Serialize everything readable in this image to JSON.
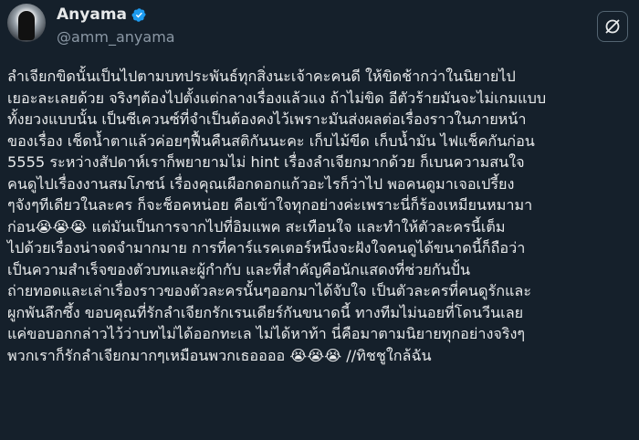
{
  "author": {
    "name": "Anyama",
    "handle": "@amm_anyama"
  },
  "post": {
    "lines": [
      "ลำเจียกขิดนั้นเป็นไปตามบทประพันธ์ทุกสิ่งนะเจ้าคะคนดี ให้ขิดช้ากว่าในนิยายไป",
      "เยอะละเลยด้วย จริงๆต้องไปตั้งแต่กลางเรื่องแล้วแง ถ้าไม่ขิด อีตัวร้ายมันจะไม่เกมแบบ",
      "ทั้งยวงแบบนั้น เป็นซีเควนซ์ที่จำเป็นต้องคงไว้เพราะมันส่งผลต่อเรื่องราวในภายหน้า",
      "ของเรื่อง เช็ดน้ำตาแล้วค่อยๆฟื้นคืนสติกันนะคะ เก็บไม้ขีด เก็บน้ำมัน ไฟแช็คกันก่อน",
      "5555  ระหว่างสัปดาห์เราก็พยายามไม่ hint เรื่องลำเจียกมากด้วย ก็เบนความสนใจ",
      "คนดูไปเรื่องงานสมโภชน์ เรื่องคุณเผือกดอกแก้วอะไรก็ว่าไป พอคนดูมาเจอเปรี้ยง",
      "ๆจังๆทีเดียวในละคร ก็จะช็อคหน่อย คือเข้าใจทุกอย่างค่ะเพราะนี่ก็ร้องเหมียนหมามา",
      "ก่อน😭😭😭 แต่มันเป็นการจากไปที่อิมแพค สะเทือนใจ และทำให้ตัวละครนี้เต็ม",
      "ไปด้วยเรื่องน่าจดจำมากมาย การที่คาร์แรคเตอร์หนึ่งจะฝังใจคนดูได้ขนาดนี้ก็ถือว่า",
      "เป็นความสำเร็จของตัวบทและผู้กำกับ และที่สำคัญคือนักแสดงที่ช่วยกันปั้น",
      "ถ่ายทอดและเล่าเรื่องราวของตัวละครนั้นๆออกมาได้จับใจ เป็นตัวละครที่คนดูรักและ",
      "ผูกพันลึกซึ้ง ขอบคุณที่รักลำเจียกรักเรนเดียร์กันขนาดนี้ ทางทีมไม่นอยที่โดนวีนเลย",
      "แค่ขอบอกกล่าวไว้ว่าบทไม่ได้ออกทะเล ไม่ได้หาท้า นี่คือมาตามนิยายทุกอย่างจริงๆ",
      "พวกเราก็รักลำเจียกมากๆเหมือนพวกเธออออ 😭😭😭  //ทิชชูใกล้ฉัน"
    ]
  },
  "colors": {
    "background": "#15202b",
    "text": "#e7e9ea",
    "secondary_text": "#8b98a5",
    "verified": "#1d9bf0"
  },
  "icons": {
    "verified": "verified-badge-icon",
    "grok": "grok-icon"
  }
}
